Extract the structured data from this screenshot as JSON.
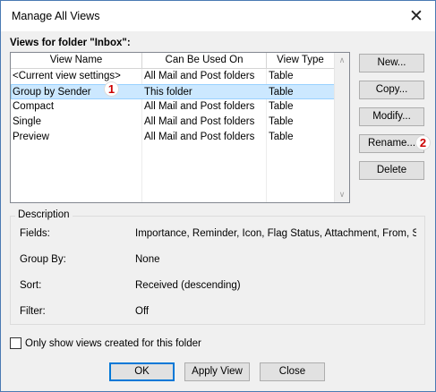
{
  "window": {
    "title": "Manage All Views",
    "close_glyph": "✕"
  },
  "views_label": "Views for folder \"Inbox\":",
  "table": {
    "headers": [
      "View Name",
      "Can Be Used On",
      "View Type"
    ],
    "rows": [
      [
        "<Current view settings>",
        "All Mail and Post folders",
        "Table"
      ],
      [
        "Group by Sender",
        "This folder",
        "Table"
      ],
      [
        "Compact",
        "All Mail and Post folders",
        "Table"
      ],
      [
        "Single",
        "All Mail and Post folders",
        "Table"
      ],
      [
        "Preview",
        "All Mail and Post folders",
        "Table"
      ]
    ],
    "selected_index": 1
  },
  "buttons": {
    "new": "New...",
    "copy": "Copy...",
    "modify": "Modify...",
    "rename": "Rename...",
    "delete": "Delete",
    "ok": "OK",
    "apply_view": "Apply View",
    "close": "Close"
  },
  "badges": {
    "one": "1",
    "two": "2",
    "color": "#c00000"
  },
  "description": {
    "title": "Description",
    "fields_label": "Fields:",
    "fields_value": "Importance, Reminder, Icon, Flag Status, Attachment, From, Su",
    "groupby_label": "Group By:",
    "groupby_value": "None",
    "sort_label": "Sort:",
    "sort_value": "Received (descending)",
    "filter_label": "Filter:",
    "filter_value": "Off"
  },
  "only_show_label": "Only show views created for this folder",
  "colors": {
    "selection": "#cce8ff",
    "selection_border": "#99d1ff",
    "accent": "#0078d7"
  }
}
